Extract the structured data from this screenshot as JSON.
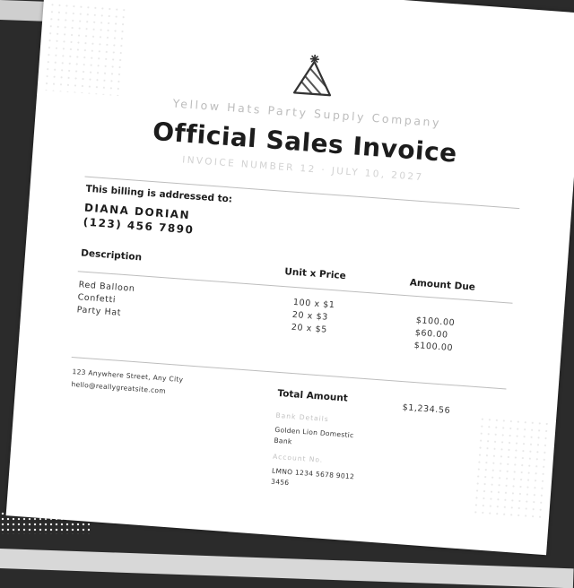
{
  "invoice": {
    "company": "Yellow Hats Party Supply Company",
    "title": "Official Sales Invoice",
    "invoice_number": "INVOICE NUMBER 12 · JULY 10, 2027",
    "billing_label": "This billing is addressed to:",
    "client_name": "DIANA DORIAN",
    "client_phone": "(123) 456 7890",
    "columns": {
      "description": "Description",
      "unit_price": "Unit x Price",
      "amount_due": "Amount Due"
    },
    "items": [
      {
        "description": "Red Balloon",
        "unit_price": "100 x $1",
        "amount": "$100.00"
      },
      {
        "description": "Confetti",
        "unit_price": "20 x $3",
        "amount": "$60.00"
      },
      {
        "description": "Party Hat",
        "unit_price": "20 x $5",
        "amount": "$100.00"
      }
    ],
    "address": "123 Anywhere Street, Any City",
    "email": "hello@reallygreatsite.com",
    "total_label": "Total Amount",
    "total_value": "$1,234.56",
    "bank_label": "Bank Details",
    "bank_name_line1": "Golden Lion Domestic",
    "bank_name_line2": "Bank",
    "account_label": "Account No.",
    "account_line1": "LMNO 1234 5678 9012",
    "account_line2": "3456"
  },
  "icons": {
    "logo": "party-hat-icon"
  },
  "colors": {
    "paper": "#ffffff",
    "ink": "#1c1c1c",
    "background": "#2b2b2b"
  }
}
